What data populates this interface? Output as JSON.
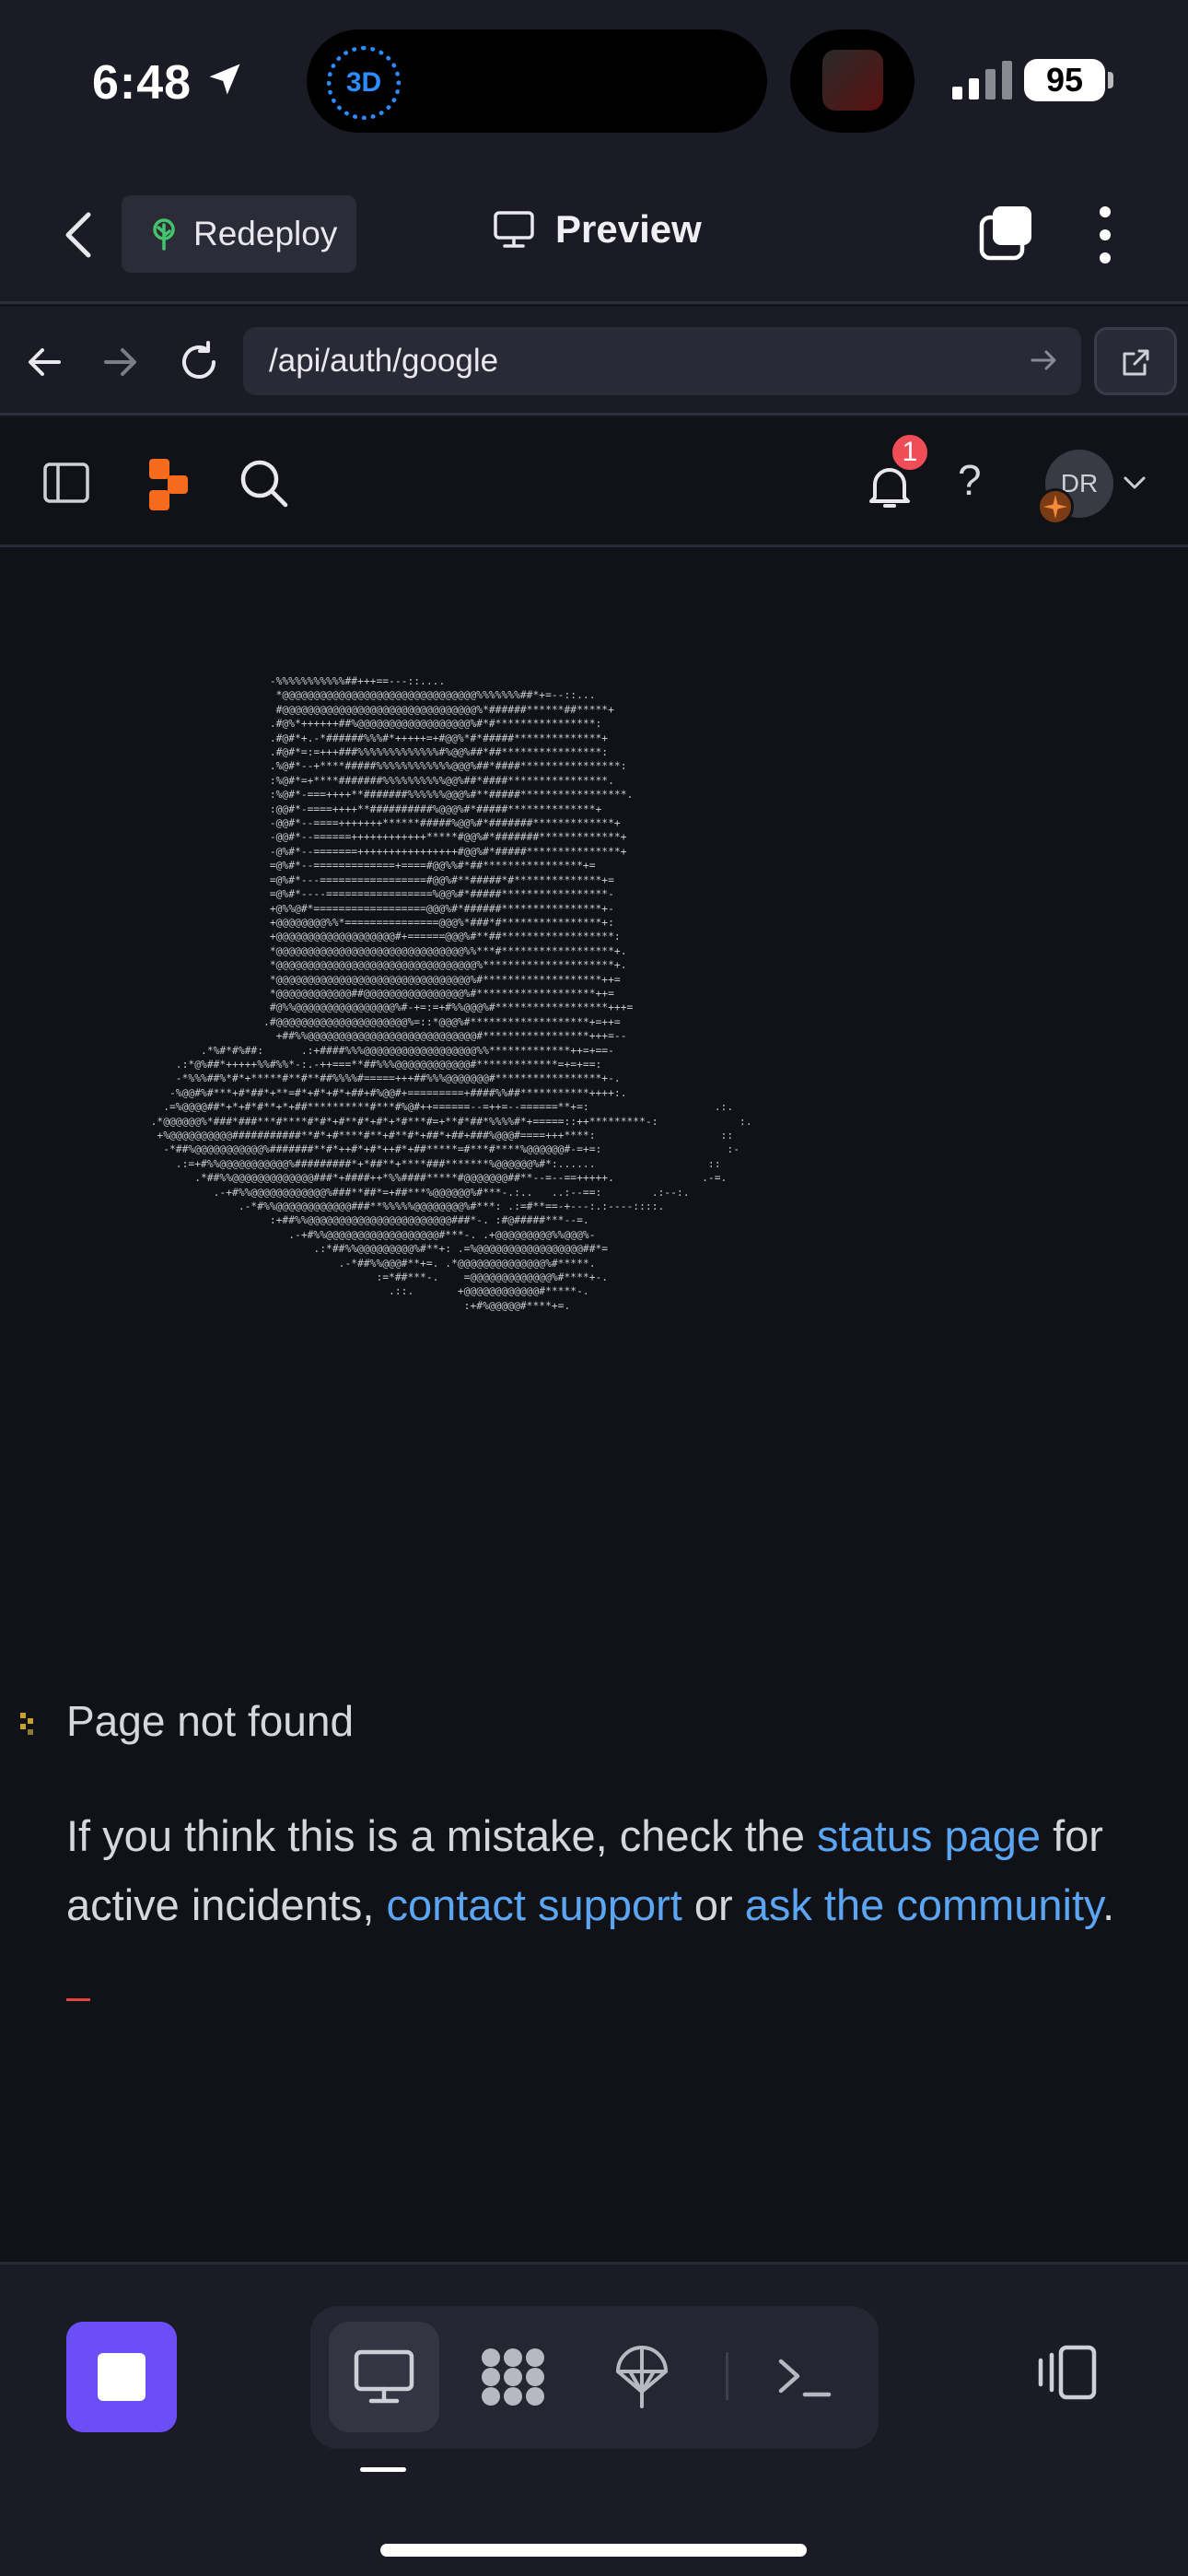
{
  "status_bar": {
    "time": "6:48",
    "badge_3d": "3D",
    "battery": "95"
  },
  "header": {
    "redeploy_label": "Redeploy",
    "preview_label": "Preview"
  },
  "url_bar": {
    "url": "/api/auth/google"
  },
  "app_header": {
    "notifications_count": "1",
    "help_label": "?",
    "avatar_initials": "DR"
  },
  "not_found": {
    "title": "Page not found",
    "msg_part1": "If you think this is a mistake, check the ",
    "link_status": "status page",
    "msg_part2": " for active incidents, ",
    "link_contact": "contact support",
    "msg_part3": " or ",
    "link_community": "ask the community",
    "msg_part4": "."
  },
  "ascii_art": "                     -%%%%%%%%%%%##+++==---::....\n                      *@@@@@@@@@@@@@@@@@@@@@@@@@@@@@@@%%%%%%%##*+=--::...\n                      #@@@@@@@@@@@@@@@@@@@@@@@@@@@@@@@%*######******##*****+\n                     .#@%*++++++##%@@@@@@@@@@@@@@@@@@%#*#****************:\n                     .#@#*+.-*######%%%#*+++++=+#@@%*#*#####**************+\n                     .#@#*=:=+++###%%%%%%%%%%%%%#%@@%##*##****************:\n                     .%@#*--+****#####%%%%%%%%%%%%@@@%##*####****************:\n                     :%@#*=+****#######%%%%%%%%%%@@%##*####****************.\n                     :%@#*-===++++**#######%%%%%%@@@%#**#####*****************.\n                     :@@#*-====++++**##########%@@@%#*#####**************+\n                     -@@#*--====+++++++******#####%@@%#*#######*************+\n                     -@@#*--======++++++++++++*****#@@%#*#######*************+\n                     -@%#*--=======++++++++++++++++#@@%#*#####***************+\n                     =@%#*--=============+====#@@%%#*##****************+=\n                     =@%#*---=================#@@%#**#####*#**************+=\n                     =@%#*----=================%@@%#*#####*****************-\n                     +@%%@#*==================@@@%#*######****************+-\n                     +@@@@@@@@%%*===============@@@%*###*#****************+:\n                     +@@@@@@@@@@@@@@@@@@@#+======@@@%#**##******************:\n                     *@@@@@@@@@@@@@@@@@@@@@@@@@@@@@@%%***#******************+.\n                     *@@@@@@@@@@@@@@@@@@@@@@@@@@@@@@@@%*********************+.\n                     *@@@@@@@@@@@@@@@@@@@@@@@@@@@@@@@%#*******************++=\n                     *@@@@@@@@@@@@##@@@@@@@@@@@@@@@@%#*******************++=\n                     #@%%@@@@@@@@@@@@@@@@%#-+=:=+#%%@@@%#******************+++=\n                    .#@@@@@@@@@@@@@@@@@@@@@%=::*@@@%#*******************+=++=\n                      +##%%@@@@@@@@@@@@@@@@@@@@@@@@@@@#*****************+++=--\n          .*%#*#%##:      .:+####%%%@@@@@@@@@@@@@@@@@@%%*************++=+==-\n      .:*@%##*+++++%%#%%*-:.-++===**##%%%@@@@@@@@@@@@#*************=+=+==:\n      -*%%%##%*#*+*****#**#**##%%%%#=====+++##%%%@@@@@@@#*****************+-.\n     -%@@#%#***+#*##*+**=#*+#*+#*+##+#%@@#+=========+####%%##***********++++:.\n    .=%@@@@##*+*+#*#**+*+##**********#***#%@#++======--=++=--======**+=:                    .:.\n  .*@@@@@@%*###*###***#****#*#*+#**#*+#*+*#***#=+**#*##*%%%%#*+=====::++*********-:             :.\n   +%@@@@@@@@@@###########**#*+#****#**+#**#*+##*+##+###%@@@#====+++****:                    ::\n    -*##%@@@@@@@@@@@%#######**#*++#*+#*++#*+##*****=#***#****%@@@@@@#-=+=:                    :-\n      .:=+#%%@@@@@@@@@@@%#########*+*##**+****###*******%@@@@@@%#*:......                  ::\n         .*##%%@@@@@@@@@@@@@###*+####++*%%####*****#@@@@@@@##**--=--==+++++.              .-=.\n            .-+#%%@@@@@@@@@@@@%###**##*=+##***%@@@@@@%#***-.:..   ..:--==:        .:--:.\n                .-*#%%@@@@@@@@@@@@###**%%%%%@@@@@@@@%#***: .:=#**==-+---:.:----::::.\n                     :+##%%@@@@@@@@@@@@@@@@@@@@@@@###*-. :#@#####***--=.\n                        .-+#%%@@@@@@@@@@@@@@@@@@#***-. .+@@@@@@@@@%%@@@%-\n                            .:*##%%@@@@@@@@@%#**+: .=%@@@@@@@@@@@@@@@@@##*=\n                                .-*##%%@@@#**+=. .*@@@@@@@@@@@@@@%#*****.\n                                      :=*##***-.    =@@@@@@@@@@@@@%#****+-.\n                                        .::.       +@@@@@@@@@@@@#*****-.\n                                                    :+#%@@@@@#****+=."
}
